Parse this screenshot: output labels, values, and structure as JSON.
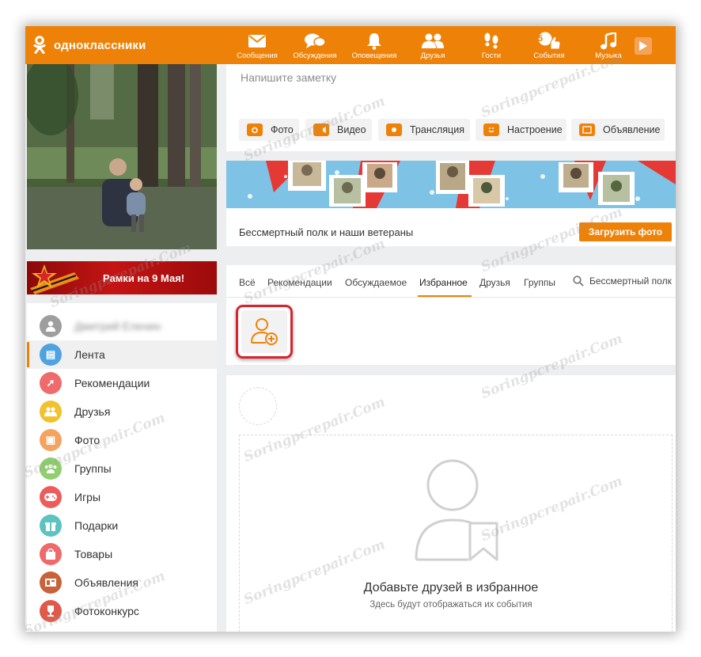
{
  "app": {
    "logo_text": "одноклассники",
    "brand_color": "#ee8208"
  },
  "nav": [
    {
      "label": "Сообщения",
      "icon": "envelope-icon"
    },
    {
      "label": "Обсуждения",
      "icon": "chat-bubbles-icon"
    },
    {
      "label": "Оповещения",
      "icon": "bell-icon"
    },
    {
      "label": "Друзья",
      "icon": "friends-icon"
    },
    {
      "label": "Гости",
      "icon": "footprints-icon"
    },
    {
      "label": "События",
      "icon": "like-events-icon",
      "badge": "5"
    },
    {
      "label": "Музыка",
      "icon": "music-note-icon"
    }
  ],
  "banner_may": {
    "text": "Рамки на 9 Мая!"
  },
  "sidebar": {
    "profile_name": "Дмитрий Еленин",
    "items": [
      {
        "label": "Лента",
        "icon": "feed-icon",
        "color": "#4fa3e0",
        "active": true
      },
      {
        "label": "Рекомендации",
        "icon": "compass-icon",
        "color": "#ef6a6a"
      },
      {
        "label": "Друзья",
        "icon": "friends-icon",
        "color": "#f2c12e"
      },
      {
        "label": "Фото",
        "icon": "photo-icon",
        "color": "#f4a460"
      },
      {
        "label": "Группы",
        "icon": "groups-icon",
        "color": "#8fcf6c"
      },
      {
        "label": "Игры",
        "icon": "gamepad-icon",
        "color": "#ee5b5b"
      },
      {
        "label": "Подарки",
        "icon": "gift-icon",
        "color": "#5bc3c0"
      },
      {
        "label": "Товары",
        "icon": "bag-icon",
        "color": "#ef6a6a"
      },
      {
        "label": "Объявления",
        "icon": "ads-icon",
        "color": "#c8623a"
      },
      {
        "label": "Фотоконкурс",
        "icon": "trophy-icon",
        "color": "#e05a4a"
      }
    ]
  },
  "note": {
    "placeholder": "Напишите заметку",
    "buttons": [
      {
        "label": "Фото",
        "icon": "camera-icon"
      },
      {
        "label": "Видео",
        "icon": "video-camera-icon"
      },
      {
        "label": "Трансляция",
        "icon": "broadcast-icon"
      },
      {
        "label": "Настроение",
        "icon": "smiley-icon"
      },
      {
        "label": "Объявление",
        "icon": "announcement-icon"
      }
    ]
  },
  "promo": {
    "text": "Бессмертный полк и наши ветераны",
    "button": "Загрузить фото"
  },
  "tabs": {
    "items": [
      "Всё",
      "Рекомендации",
      "Обсуждаемое",
      "Избранное",
      "Друзья",
      "Группы"
    ],
    "active": "Избранное",
    "search_label": "Бессмертный полк"
  },
  "empty_state": {
    "title": "Добавьте друзей в избранное",
    "subtitle": "Здесь будут отображаться их события"
  },
  "watermark": "Soringpcrepair.Com"
}
